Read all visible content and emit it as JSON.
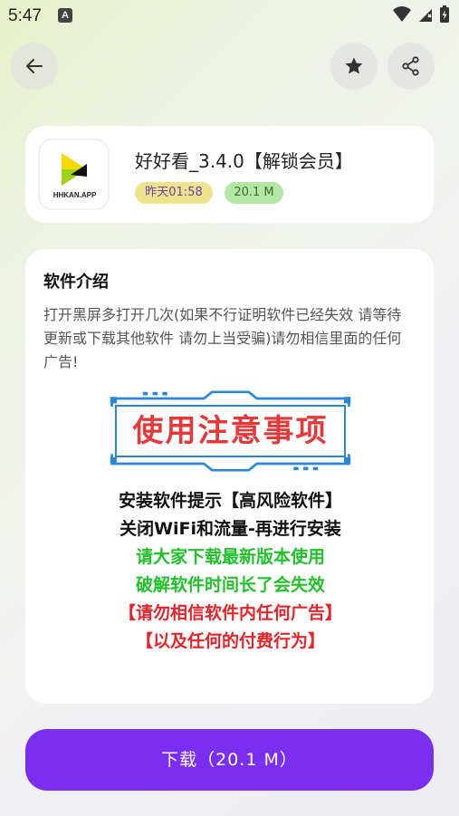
{
  "status_bar": {
    "time": "5:47",
    "notif_icon": "A"
  },
  "header": {
    "back_icon": "arrow-left-icon",
    "favorite_icon": "star-icon",
    "share_icon": "share-icon"
  },
  "app": {
    "name": "好好看_3.4.0【解锁会员】",
    "icon_text": "HHKAN.APP",
    "updated": "昨天01:58",
    "size": "20.1 M"
  },
  "intro": {
    "title": "软件介绍",
    "description": "打开黑屏多打开几次(如果不行证明软件已经失效 请等待更新或下载其他软件 请勿上当受骗)请勿相信里面的任何广告!",
    "notice": {
      "headline": "使用注意事项",
      "lines": [
        {
          "text": "安装软件提示【高风险软件】",
          "color": "#111111"
        },
        {
          "text": "关闭WiFi和流量-再进行安装",
          "color": "#111111"
        },
        {
          "text": "请大家下载最新版本使用",
          "color": "#22c02a"
        },
        {
          "text": "破解软件时间长了会失效",
          "color": "#22c02a"
        },
        {
          "text": "【请勿相信软件内任何广告】",
          "color": "#e5242a"
        },
        {
          "text": "【以及任何的付费行为】",
          "color": "#e5242a"
        }
      ]
    }
  },
  "download_button": {
    "label": "下载（20.1 M）"
  },
  "colors": {
    "accent": "#7a2ef0",
    "badge_time_bg": "#ece38c",
    "badge_size_bg": "#b4e6a4"
  }
}
